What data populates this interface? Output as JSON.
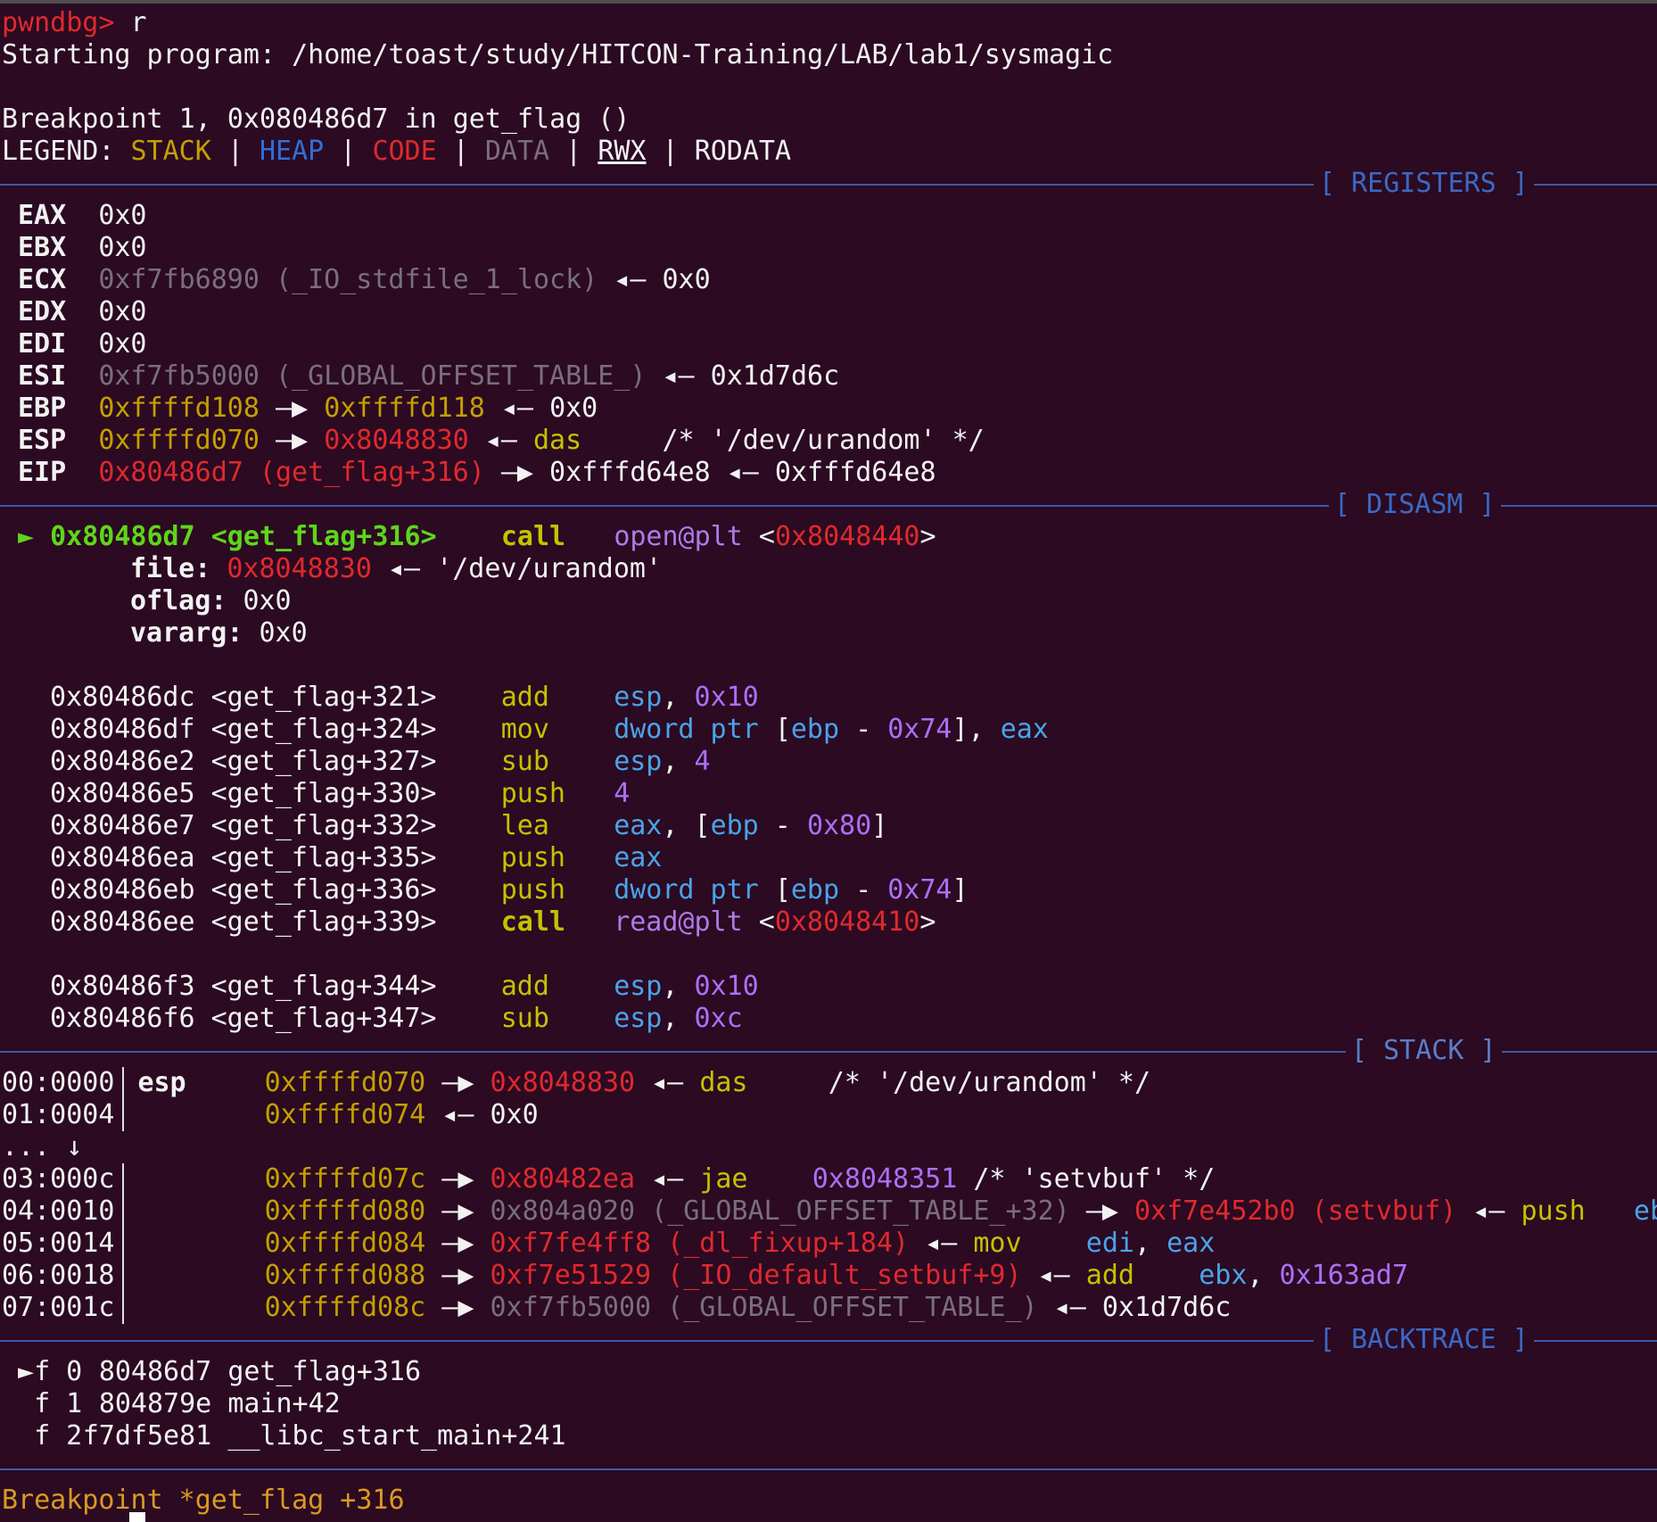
{
  "prompt": {
    "label": "pwndbg>",
    "command": " r"
  },
  "start": {
    "text": "Starting program: /home/toast/study/HITCON-Training/LAB/lab1/sysmagic"
  },
  "bp_hit": {
    "text": "Breakpoint 1, 0x080486d7 in get_flag ()"
  },
  "legend": {
    "label": "LEGEND: ",
    "stack": "STACK",
    "heap": "HEAP",
    "code": "CODE",
    "data": "DATA",
    "rwx": "RWX",
    "rodata": "RODATA",
    "sep": " | "
  },
  "sections": {
    "registers": "[ REGISTERS ]",
    "disasm": "[ DISASM ]",
    "stack": "[ STACK ]",
    "backtrace": "[ BACKTRACE ]"
  },
  "arrows": {
    "right": " —▶ ",
    "left": " ◂— "
  },
  "registers": {
    "eax": {
      "name": "EAX",
      "value": "0x0"
    },
    "ebx": {
      "name": "EBX",
      "value": "0x0"
    },
    "ecx": {
      "name": "ECX",
      "addr": "0xf7fb6890 (_IO_stdfile_1_lock)",
      "deref": "0x0"
    },
    "edx": {
      "name": "EDX",
      "value": "0x0"
    },
    "edi": {
      "name": "EDI",
      "value": "0x0"
    },
    "esi": {
      "name": "ESI",
      "addr": "0xf7fb5000 (_GLOBAL_OFFSET_TABLE_)",
      "deref": "0x1d7d6c"
    },
    "ebp": {
      "name": "EBP",
      "addr": "0xffffd108",
      "p1": "0xffffd118",
      "deref": "0x0"
    },
    "esp": {
      "name": "ESP",
      "addr": "0xffffd070",
      "p1": "0x8048830",
      "instr": "das",
      "comment": "/* '/dev/urandom' */"
    },
    "eip": {
      "name": "EIP",
      "addr": "0x80486d7 (get_flag+316)",
      "p1": "0xfffd64e8",
      "deref": "0xfffd64e8"
    }
  },
  "disasm": {
    "current": {
      "marker": "►",
      "addr": "0x80486d7",
      "sym": "<get_flag+316>",
      "mnem": "call",
      "target": "open@plt",
      "target_addr": "0x8048440"
    },
    "args": [
      {
        "name": "file:",
        "value": "0x8048830",
        "str": "'/dev/urandom'"
      },
      {
        "name": "oflag:",
        "value": "0x0"
      },
      {
        "name": "vararg:",
        "value": "0x0"
      }
    ],
    "rows": [
      {
        "addr": "0x80486dc",
        "sym": "<get_flag+321>",
        "mnem": "add",
        "ops": [
          {
            "t": "esp",
            "c": "reg"
          },
          {
            "t": ", ",
            "c": ""
          },
          {
            "t": "0x10",
            "c": "num"
          }
        ]
      },
      {
        "addr": "0x80486df",
        "sym": "<get_flag+324>",
        "mnem": "mov",
        "ops": [
          {
            "t": "dword ptr ",
            "c": "reg"
          },
          {
            "t": "[",
            "c": ""
          },
          {
            "t": "ebp",
            "c": "reg"
          },
          {
            "t": " - ",
            "c": ""
          },
          {
            "t": "0x74",
            "c": "num"
          },
          {
            "t": "], ",
            "c": ""
          },
          {
            "t": "eax",
            "c": "reg"
          }
        ]
      },
      {
        "addr": "0x80486e2",
        "sym": "<get_flag+327>",
        "mnem": "sub",
        "ops": [
          {
            "t": "esp",
            "c": "reg"
          },
          {
            "t": ", ",
            "c": ""
          },
          {
            "t": "4",
            "c": "num"
          }
        ]
      },
      {
        "addr": "0x80486e5",
        "sym": "<get_flag+330>",
        "mnem": "push",
        "ops": [
          {
            "t": "4",
            "c": "num"
          }
        ]
      },
      {
        "addr": "0x80486e7",
        "sym": "<get_flag+332>",
        "mnem": "lea",
        "ops": [
          {
            "t": "eax",
            "c": "reg"
          },
          {
            "t": ", [",
            "c": ""
          },
          {
            "t": "ebp",
            "c": "reg"
          },
          {
            "t": " - ",
            "c": ""
          },
          {
            "t": "0x80",
            "c": "num"
          },
          {
            "t": "]",
            "c": ""
          }
        ]
      },
      {
        "addr": "0x80486ea",
        "sym": "<get_flag+335>",
        "mnem": "push",
        "ops": [
          {
            "t": "eax",
            "c": "reg"
          }
        ]
      },
      {
        "addr": "0x80486eb",
        "sym": "<get_flag+336>",
        "mnem": "push",
        "ops": [
          {
            "t": "dword ptr ",
            "c": "reg"
          },
          {
            "t": "[",
            "c": ""
          },
          {
            "t": "ebp",
            "c": "reg"
          },
          {
            "t": " - ",
            "c": ""
          },
          {
            "t": "0x74",
            "c": "num"
          },
          {
            "t": "]",
            "c": ""
          }
        ]
      },
      {
        "addr": "0x80486ee",
        "sym": "<get_flag+339>",
        "mnem": "call",
        "bold": true,
        "ops": [
          {
            "t": "read@plt",
            "c": "sym"
          },
          {
            "t": " <",
            "c": ""
          },
          {
            "t": "0x8048410",
            "c": "red"
          },
          {
            "t": ">",
            "c": ""
          }
        ]
      },
      {
        "addr": "0x80486f3",
        "sym": "<get_flag+344>",
        "mnem": "add",
        "ops": [
          {
            "t": "esp",
            "c": "reg"
          },
          {
            "t": ", ",
            "c": ""
          },
          {
            "t": "0x10",
            "c": "num"
          }
        ]
      },
      {
        "addr": "0x80486f6",
        "sym": "<get_flag+347>",
        "mnem": "sub",
        "ops": [
          {
            "t": "esp",
            "c": "reg"
          },
          {
            "t": ", ",
            "c": ""
          },
          {
            "t": "0xc",
            "c": "num"
          }
        ]
      }
    ]
  },
  "stack": {
    "rows": [
      {
        "idx": "00:0000",
        "reg": "esp",
        "addr": "0xffffd070",
        "parts": [
          {
            "t": " —▶ ",
            "c": ""
          },
          {
            "t": "0x8048830",
            "c": "red"
          },
          {
            "t": " ◂— ",
            "c": ""
          },
          {
            "t": "das",
            "c": "mnem"
          },
          {
            "t": "     /* '/dev/urandom' */",
            "c": ""
          }
        ]
      },
      {
        "idx": "01:0004",
        "reg": "",
        "addr": "0xffffd074",
        "parts": [
          {
            "t": " ◂— 0x0",
            "c": ""
          }
        ]
      },
      {
        "idx": "03:000c",
        "reg": "",
        "addr": "0xffffd07c",
        "parts": [
          {
            "t": " —▶ ",
            "c": ""
          },
          {
            "t": "0x80482ea",
            "c": "red"
          },
          {
            "t": " ◂— ",
            "c": ""
          },
          {
            "t": "jae",
            "c": "mnem"
          },
          {
            "t": "    ",
            "c": ""
          },
          {
            "t": "0x8048351",
            "c": "num"
          },
          {
            "t": " /* 'setvbuf' */",
            "c": ""
          }
        ]
      },
      {
        "idx": "04:0010",
        "reg": "",
        "addr": "0xffffd080",
        "parts": [
          {
            "t": " —▶ ",
            "c": ""
          },
          {
            "t": "0x804a020 (_GLOBAL_OFFSET_TABLE_+32)",
            "c": "grey"
          },
          {
            "t": " —▶ ",
            "c": ""
          },
          {
            "t": "0xf7e452b0 (setvbuf)",
            "c": "red"
          },
          {
            "t": " ◂— ",
            "c": ""
          },
          {
            "t": "push",
            "c": "mnem"
          },
          {
            "t": "   ",
            "c": ""
          },
          {
            "t": "ebp",
            "c": "reg"
          }
        ]
      },
      {
        "idx": "05:0014",
        "reg": "",
        "addr": "0xffffd084",
        "parts": [
          {
            "t": " —▶ ",
            "c": ""
          },
          {
            "t": "0xf7fe4ff8 (_dl_fixup+184)",
            "c": "red"
          },
          {
            "t": " ◂— ",
            "c": ""
          },
          {
            "t": "mov",
            "c": "mnem"
          },
          {
            "t": "    ",
            "c": ""
          },
          {
            "t": "edi",
            "c": "reg"
          },
          {
            "t": ", ",
            "c": ""
          },
          {
            "t": "eax",
            "c": "reg"
          }
        ]
      },
      {
        "idx": "06:0018",
        "reg": "",
        "addr": "0xffffd088",
        "parts": [
          {
            "t": " —▶ ",
            "c": ""
          },
          {
            "t": "0xf7e51529 (_IO_default_setbuf+9)",
            "c": "red"
          },
          {
            "t": " ◂— ",
            "c": ""
          },
          {
            "t": "add",
            "c": "mnem"
          },
          {
            "t": "    ",
            "c": ""
          },
          {
            "t": "ebx",
            "c": "reg"
          },
          {
            "t": ", ",
            "c": ""
          },
          {
            "t": "0x163ad7",
            "c": "num"
          }
        ]
      },
      {
        "idx": "07:001c",
        "reg": "",
        "addr": "0xffffd08c",
        "parts": [
          {
            "t": " —▶ ",
            "c": ""
          },
          {
            "t": "0xf7fb5000 (_GLOBAL_OFFSET_TABLE_)",
            "c": "grey"
          },
          {
            "t": " ◂— 0x1d7d6c",
            "c": ""
          }
        ]
      }
    ],
    "skip": "... ↓"
  },
  "backtrace": {
    "marker": "►",
    "frames": [
      {
        "f": "f 0",
        "addr": "80486d7",
        "sym": "get_flag+316"
      },
      {
        "f": "f 1",
        "addr": "804879e",
        "sym": "main+42"
      },
      {
        "f": "f 2",
        "addr": "f7df5e81",
        "sym": "__libc_start_main+241"
      }
    ]
  },
  "footer": {
    "text": "Breakpoint *get_flag +316"
  }
}
